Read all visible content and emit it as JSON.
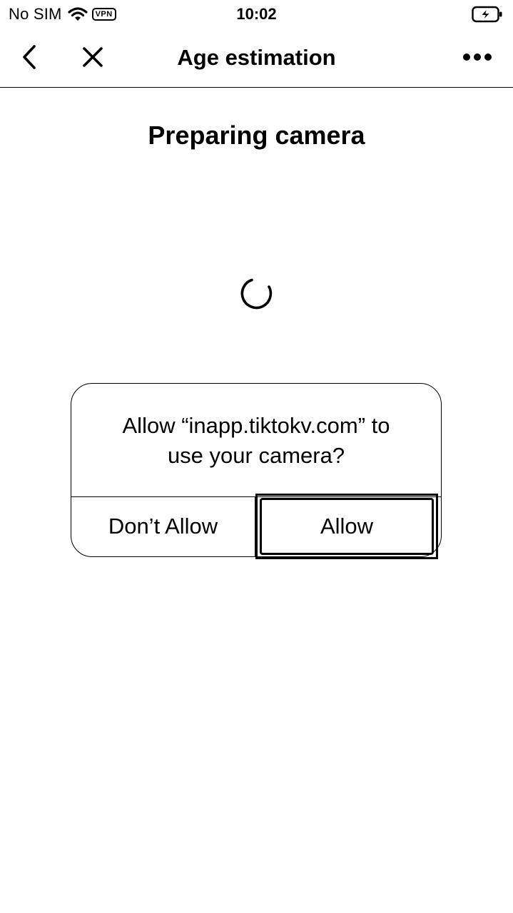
{
  "status_bar": {
    "carrier": "No SIM",
    "vpn": "VPN",
    "time": "10:02",
    "icons": [
      "wifi-icon",
      "battery-charging-icon"
    ]
  },
  "nav": {
    "title": "Age estimation",
    "icons": [
      "chevron-left-icon",
      "close-icon",
      "more-horizontal-icon"
    ]
  },
  "content": {
    "heading": "Preparing camera",
    "loading_icon": "spinner-icon"
  },
  "alert": {
    "message_line1": "Allow “inapp.tiktokv.com” to",
    "message_line2": "use your camera?",
    "deny_label": "Don’t Allow",
    "allow_label": "Allow"
  }
}
